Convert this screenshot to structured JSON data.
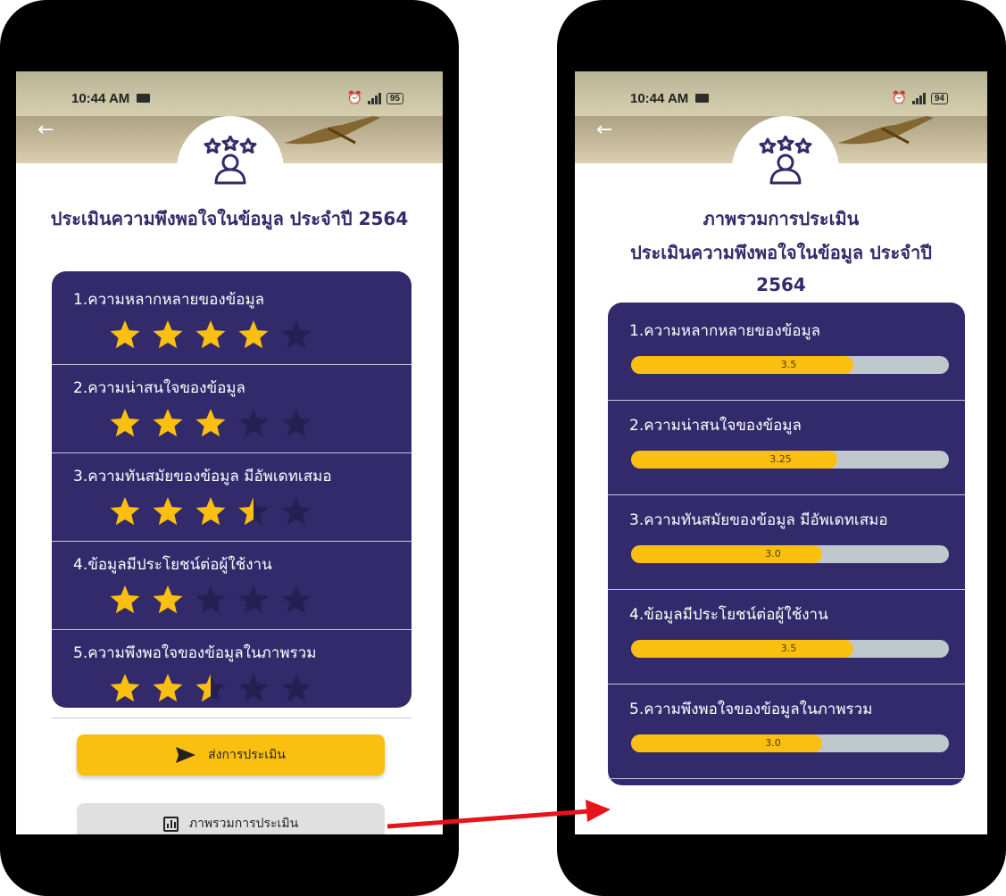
{
  "status_bar": {
    "left": {
      "time": "10:44 AM",
      "battery": "95"
    },
    "right": {
      "time": "10:44 AM",
      "battery": "94"
    }
  },
  "rating_screen": {
    "title": "ประเมินความพึงพอใจในข้อมูล ประจำปี 2564",
    "questions": [
      {
        "label": "1.ความหลากหลายของข้อมูล",
        "stars": 4,
        "max_stars": 5
      },
      {
        "label": "2.ความน่าสนใจของข้อมูล",
        "stars": 3,
        "max_stars": 5
      },
      {
        "label": "3.ความทันสมัยของข้อมูล มีอัพเดทเสมอ",
        "stars": 3.5,
        "max_stars": 5
      },
      {
        "label": "4.ข้อมูลมีประโยชน์ต่อผู้ใช้งาน",
        "stars": 2,
        "max_stars": 5
      },
      {
        "label": "5.ความพึงพอใจของข้อมูลในภาพรวม",
        "stars": 2.5,
        "max_stars": 5
      }
    ],
    "submit_label": "ส่งการประเมิน",
    "summary_label": "ภาพรวมการประเมิน"
  },
  "summary_screen": {
    "title_line1": "ภาพรวมการประเมิน",
    "title_line2": "ประเมินความพึงพอใจในข้อมูล ประจำปี",
    "title_line3": "2564",
    "results": [
      {
        "label": "1.ความหลากหลายของข้อมูล",
        "score": 3.5,
        "score_text": "3.5",
        "max": 5
      },
      {
        "label": "2.ความน่าสนใจของข้อมูล",
        "score": 3.25,
        "score_text": "3.25",
        "max": 5
      },
      {
        "label": "3.ความทันสมัยของข้อมูล มีอัพเดทเสมอ",
        "score": 3.0,
        "score_text": "3.0",
        "max": 5
      },
      {
        "label": "4.ข้อมูลมีประโยชน์ต่อผู้ใช้งาน",
        "score": 3.5,
        "score_text": "3.5",
        "max": 5
      },
      {
        "label": "5.ความพึงพอใจของข้อมูลในภาพรวม",
        "score": 3.0,
        "score_text": "3.0",
        "max": 5
      }
    ]
  },
  "colors": {
    "panel": "#322a6b",
    "accent_yellow": "#fbc00f",
    "title": "#332b6a",
    "star_empty": "#262052",
    "bar_track": "#bfc8cc",
    "arrow": "#e8141c"
  },
  "icons": {
    "back": "back-arrow-icon",
    "emblem": "user-rating-icon",
    "send": "send-icon",
    "chart": "bar-chart-icon"
  }
}
